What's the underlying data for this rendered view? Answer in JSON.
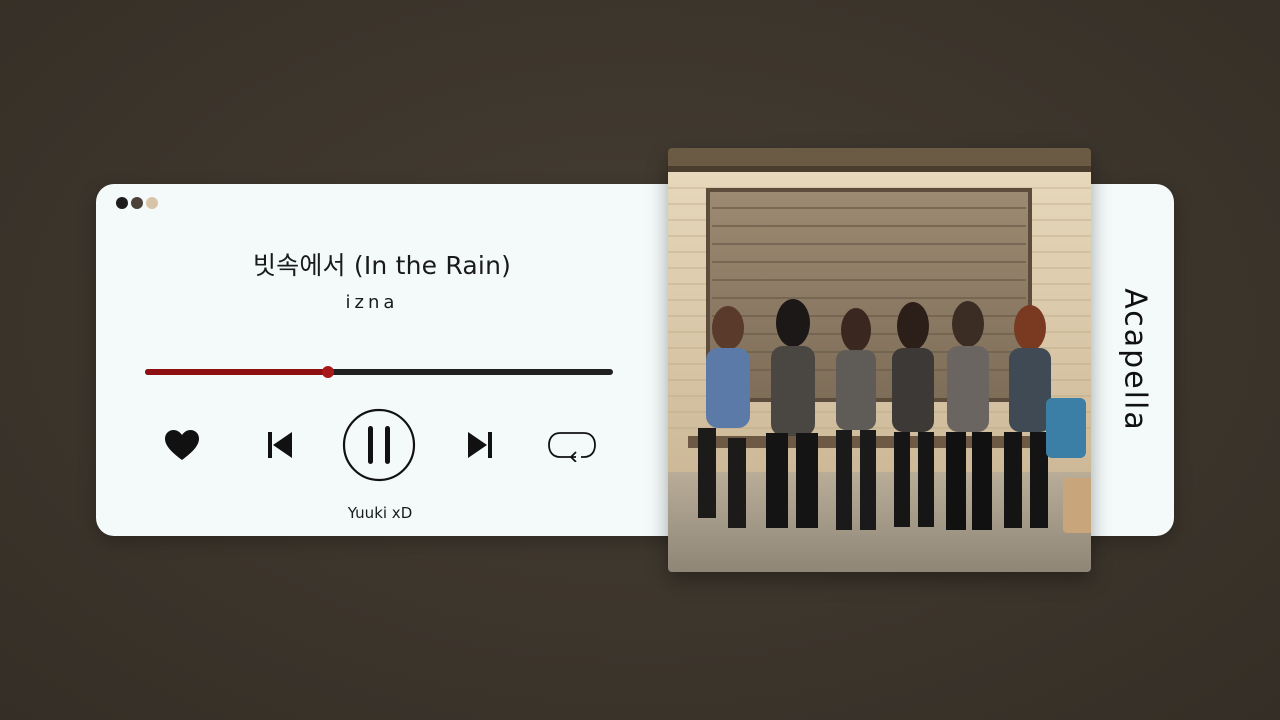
{
  "player": {
    "window_dots": [
      "#1c1c1c",
      "#4b4138",
      "#d8c4a8"
    ],
    "song_title": "빗속에서 (In the Rain)",
    "artist": "izna",
    "progress": 0.39,
    "accent_color": "#8e0f12",
    "controls": {
      "like_icon": "heart-icon",
      "previous_icon": "skip-previous-icon",
      "play_pause_icon": "pause-icon",
      "next_icon": "skip-next-icon",
      "repeat_icon": "repeat-icon"
    },
    "credit": "Yuuki xD",
    "side_label": "Acapella"
  },
  "album_art": {
    "description_icon": "album-cover-photo"
  }
}
